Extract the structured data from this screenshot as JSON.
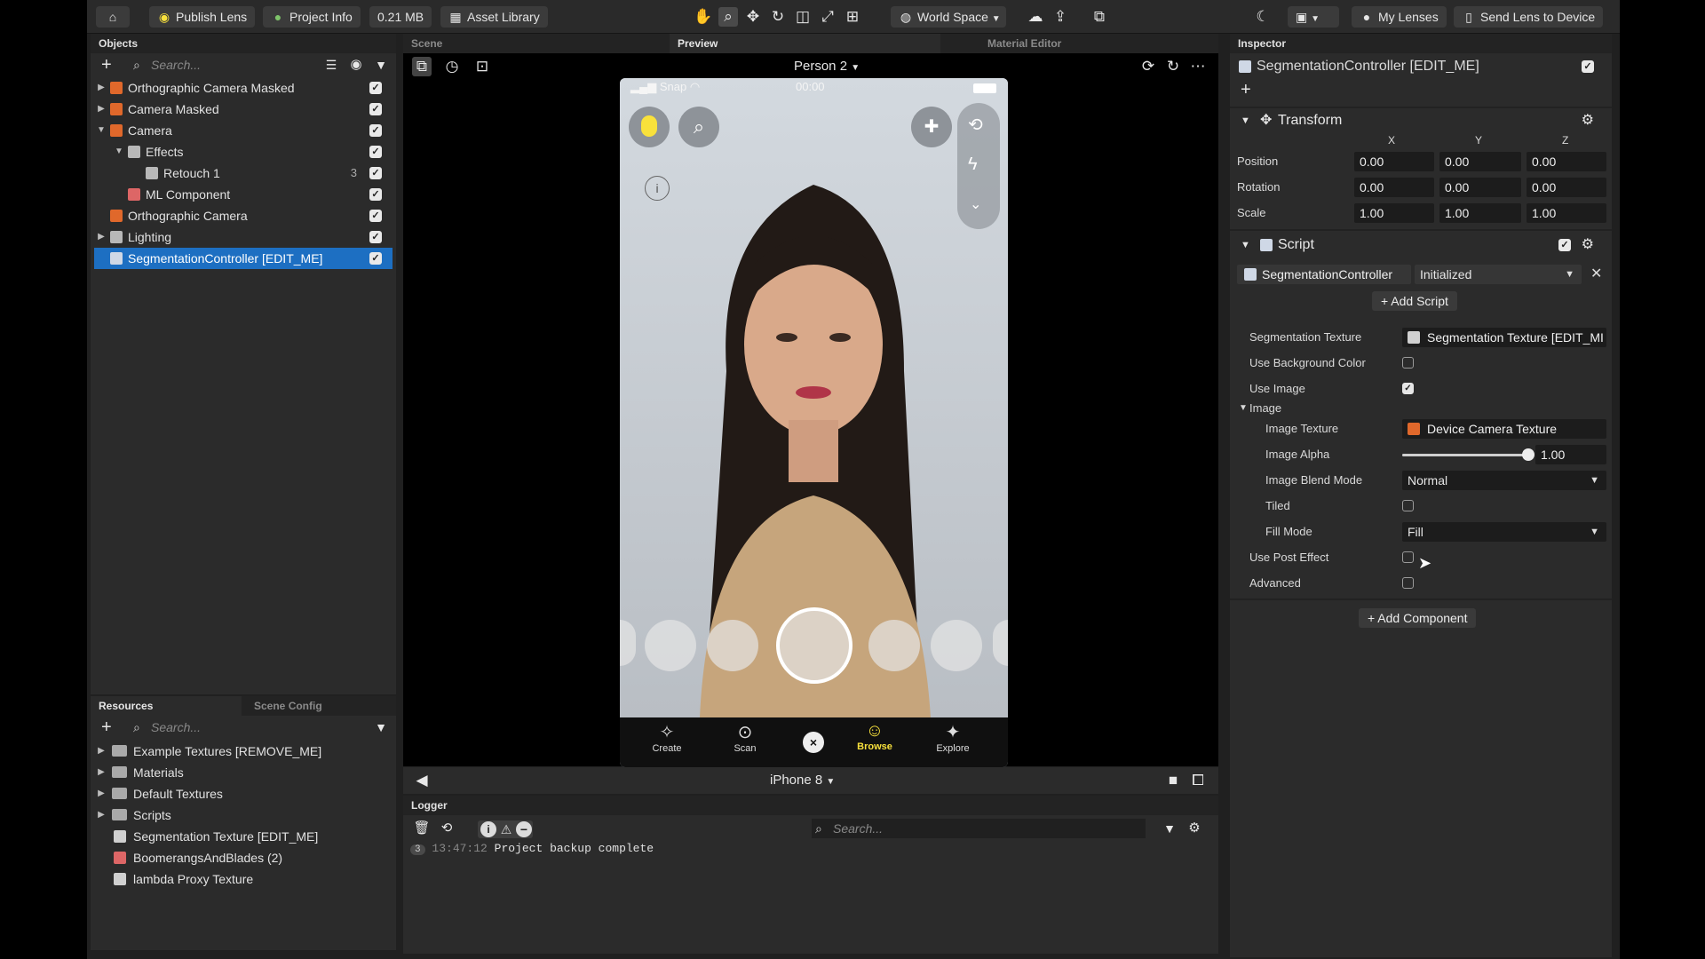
{
  "toolbar": {
    "publish_lens": "Publish Lens",
    "project_info": "Project Info",
    "project_size": "0.21 MB",
    "asset_library": "Asset Library",
    "world_space": "World Space",
    "my_lenses": "My Lenses",
    "send_lens": "Send Lens to Device"
  },
  "objects": {
    "title": "Objects",
    "search_placeholder": "Search...",
    "items": [
      {
        "label": "Orthographic Camera Masked",
        "color": "#e0682b"
      },
      {
        "label": "Camera Masked",
        "color": "#e0682b"
      },
      {
        "label": "Camera",
        "color": "#e0682b"
      },
      {
        "label": "Effects",
        "color": "#b8b8b8"
      },
      {
        "label": "Retouch 1",
        "count": "3",
        "color": "#b8b8b8"
      },
      {
        "label": "ML Component",
        "color": "#d66"
      },
      {
        "label": "Orthographic Camera",
        "color": "#e0682b"
      },
      {
        "label": "Lighting",
        "color": "#b8b8b8"
      },
      {
        "label": "SegmentationController [EDIT_ME]",
        "color": "#cfd8e6"
      }
    ]
  },
  "resources": {
    "tab_resources": "Resources",
    "tab_scene_config": "Scene Config",
    "search_placeholder": "Search...",
    "items": [
      {
        "label": "Example Textures [REMOVE_ME]"
      },
      {
        "label": "Materials"
      },
      {
        "label": "Default Textures"
      },
      {
        "label": "Scripts"
      },
      {
        "label": "Segmentation Texture [EDIT_ME]"
      },
      {
        "label": "BoomerangsAndBlades (2)"
      },
      {
        "label": "lambda Proxy Texture"
      }
    ]
  },
  "viewport": {
    "tab_scene": "Scene",
    "tab_preview": "Preview",
    "tab_material_editor": "Material Editor",
    "person_select": "Person 2",
    "device_select": "iPhone 8"
  },
  "phone": {
    "carrier": "Snap",
    "time": "00:00",
    "nav": [
      "Create",
      "Scan",
      "Browse",
      "Explore"
    ]
  },
  "logger": {
    "title": "Logger",
    "search_placeholder": "Search...",
    "entry_count": "3",
    "entry_time": "13:47:12",
    "entry_text": "Project backup complete"
  },
  "inspector": {
    "title": "Inspector",
    "object_name": "SegmentationController [EDIT_ME]",
    "transform": {
      "title": "Transform",
      "axis_x": "X",
      "axis_y": "Y",
      "axis_z": "Z",
      "position_label": "Position",
      "position": [
        "0.00",
        "0.00",
        "0.00"
      ],
      "rotation_label": "Rotation",
      "rotation": [
        "0.00",
        "0.00",
        "0.00"
      ],
      "scale_label": "Scale",
      "scale": [
        "1.00",
        "1.00",
        "1.00"
      ]
    },
    "script": {
      "title": "Script",
      "script_name": "SegmentationController",
      "event": "Initialized",
      "add_script": "Add Script",
      "segmentation_texture_label": "Segmentation Texture",
      "segmentation_texture_value": "Segmentation Texture [EDIT_MI",
      "use_bg_color_label": "Use Background Color",
      "use_image_label": "Use Image",
      "image_group_label": "Image",
      "image_texture_label": "Image Texture",
      "image_texture_value": "Device Camera Texture",
      "image_alpha_label": "Image Alpha",
      "image_alpha_value": "1.00",
      "image_alpha_level": 1.0,
      "blend_mode_label": "Image Blend Mode",
      "blend_mode_value": "Normal",
      "tiled_label": "Tiled",
      "fill_mode_label": "Fill Mode",
      "fill_mode_value": "Fill",
      "use_post_effect_label": "Use Post Effect",
      "advanced_label": "Advanced"
    },
    "add_component": "Add Component"
  }
}
